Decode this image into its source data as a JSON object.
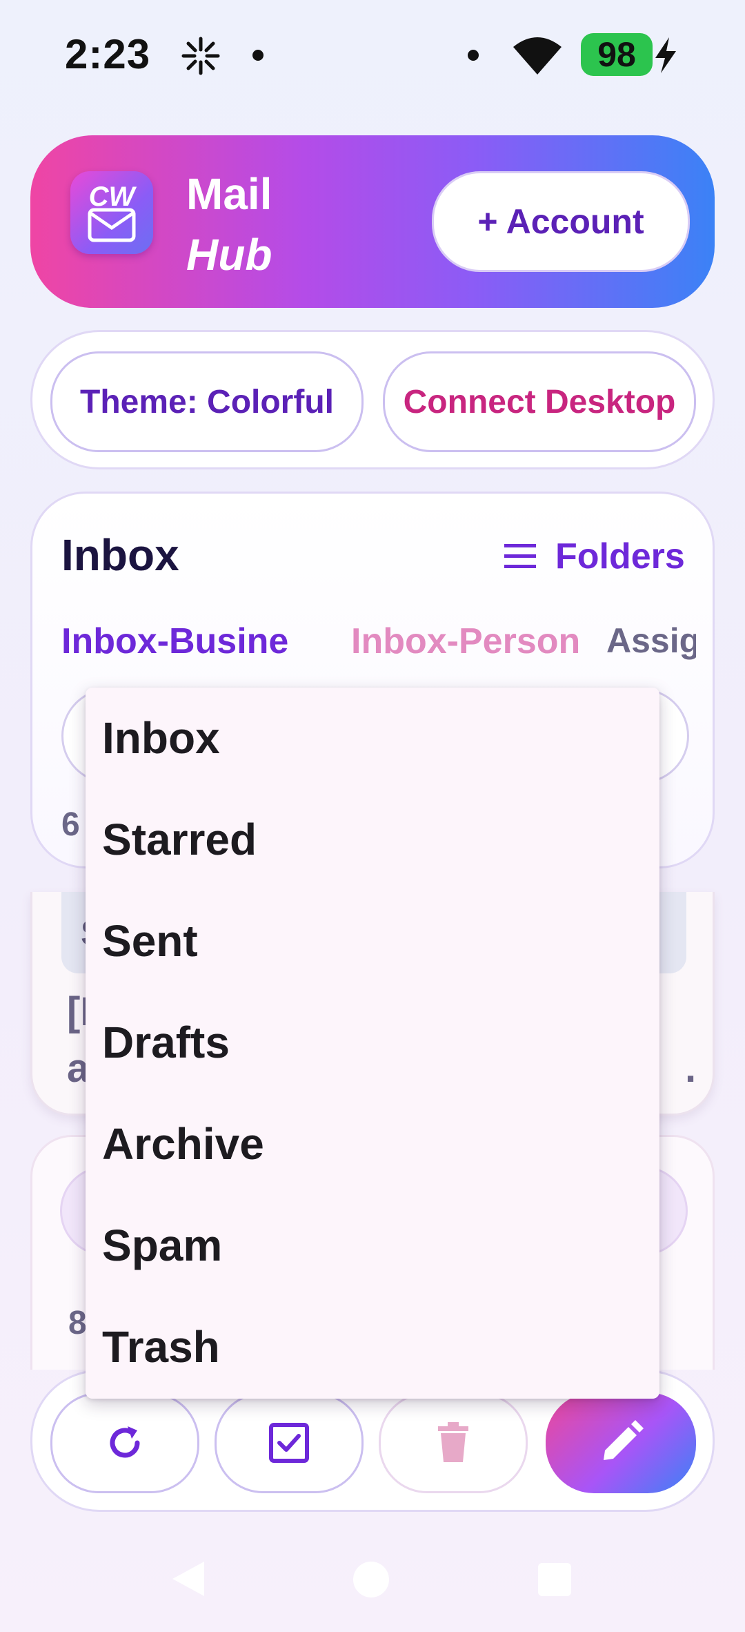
{
  "status_bar": {
    "time": "2:23",
    "battery": "98"
  },
  "header": {
    "logo_text": "CW",
    "title_line1": "Mail",
    "title_line2": "Hub",
    "account_button": "+ Account"
  },
  "chips": {
    "theme": "Theme: Colorful",
    "desktop": "Connect Desktop"
  },
  "inbox": {
    "title": "Inbox",
    "folders_button": "Folders",
    "tabs": [
      "Inbox-Busine",
      "Inbox-Person",
      "Assign"
    ],
    "count_visible": "6"
  },
  "mail_cards": [
    {
      "chip_fragment": "S",
      "subject_line1_fragment": "[I",
      "subject_line2_fragment": "a",
      "subject_trailing": "."
    },
    {
      "count_fragment": "8"
    }
  ],
  "dropdown": {
    "items": [
      "Inbox",
      "Starred",
      "Sent",
      "Drafts",
      "Archive",
      "Spam",
      "Trash"
    ]
  },
  "colors": {
    "accent_purple": "#6d28d9",
    "accent_pink": "#c8257f",
    "header_gradient_start": "#ef45a4",
    "header_gradient_end": "#3b82f6",
    "battery_green": "#2cc44e"
  },
  "icons": {
    "refresh": "refresh-icon",
    "select": "checkbox-icon",
    "delete": "trash-icon",
    "compose": "pencil-icon",
    "folders": "menu-icon"
  }
}
